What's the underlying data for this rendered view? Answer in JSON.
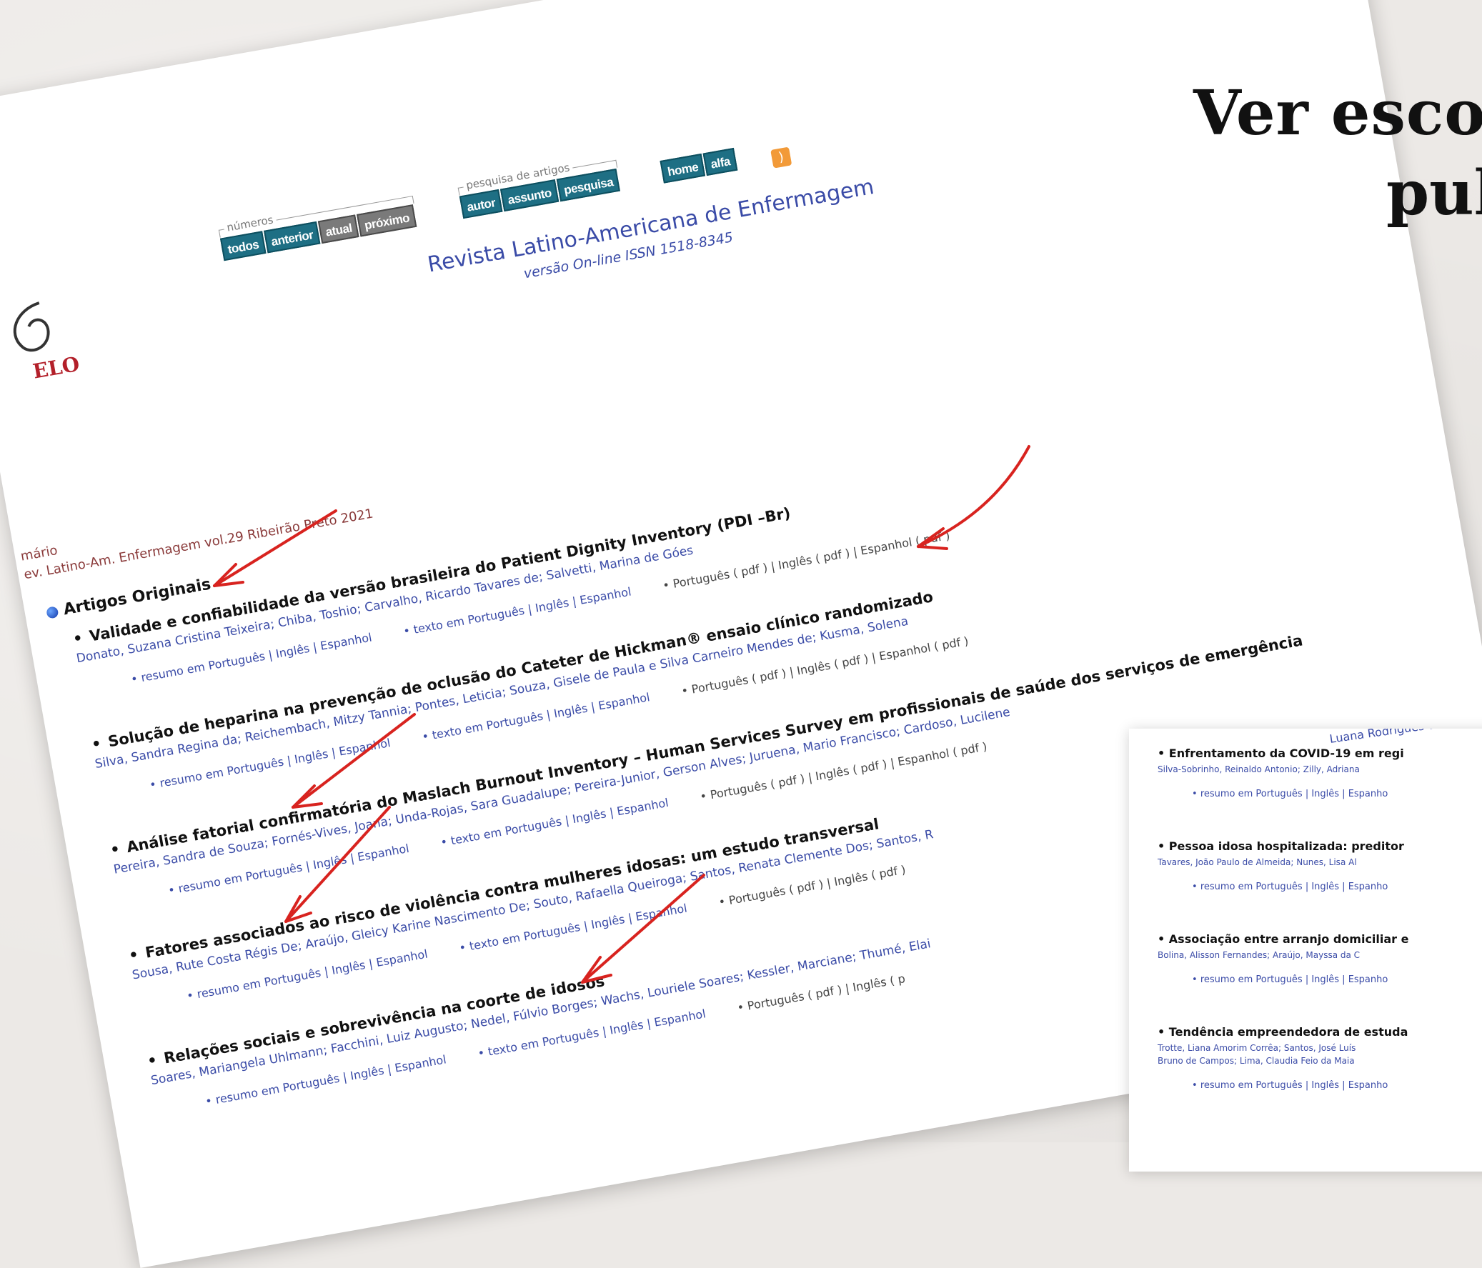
{
  "heading": {
    "line1": "Ver esco",
    "line2": "pul"
  },
  "nav": {
    "group_numeros": "números",
    "group_pesquisa": "pesquisa de artigos",
    "buttons_numeros": [
      "todos",
      "anterior",
      "atual",
      "próximo"
    ],
    "buttons_pesquisa": [
      "autor",
      "assunto",
      "pesquisa"
    ],
    "buttons_misc": [
      "home",
      "alfa"
    ]
  },
  "logo_text": "ELO",
  "journal": {
    "title": "Revista Latino-Americana de Enfermagem",
    "subtitle": "versão On-line ISSN 1518-8345"
  },
  "breadcrumb": {
    "line1": "mário",
    "line2": "ev. Latino-Am. Enfermagem vol.29  Ribeirão Preto  2021"
  },
  "section": "Artigos Originais",
  "articles": [
    {
      "title": "Validade e confiabilidade da versão brasileira do Patient Dignity Inventory (PDI –Br)",
      "authors": "Donato, Suzana Cristina Teixeira; Chiba, Toshio; Carvalho, Ricardo Tavares de; Salvetti, Marina de Góes",
      "resumo": "resumo em Português | Inglês | Espanhol",
      "texto": "texto em Português | Inglês | Espanhol",
      "pdf": "Português ( pdf ) | Inglês ( pdf ) | Espanhol ( pdf )"
    },
    {
      "title": "Solução de heparina na prevenção de oclusão do Cateter de Hickman® ensaio clínico randomizado",
      "authors": "Silva, Sandra Regina da; Reichembach, Mitzy Tannia; Pontes, Leticia; Souza, Gisele de Paula e Silva Carneiro Mendes de; Kusma, Solena",
      "resumo": "resumo em Português | Inglês | Espanhol",
      "texto": "texto em Português | Inglês | Espanhol",
      "pdf": "Português ( pdf ) | Inglês ( pdf ) | Espanhol ( pdf )"
    },
    {
      "title": "Análise fatorial confirmatória do Maslach Burnout Inventory – Human Services Survey em profissionais de saúde dos serviços de emergência",
      "authors": "Pereira, Sandra de Souza; Fornés-Vives, Joana; Unda-Rojas, Sara Guadalupe; Pereira-Junior, Gerson Alves; Juruena, Mario Francisco; Cardoso, Lucilene",
      "resumo": "resumo em Português | Inglês | Espanhol",
      "texto": "texto em Português | Inglês | Espanhol",
      "pdf": "Português ( pdf ) | Inglês ( pdf ) | Espanhol ( pdf )"
    },
    {
      "title": "Fatores associados ao risco de violência contra mulheres idosas: um estudo transversal",
      "authors": "Sousa, Rute Costa Régis De; Araújo, Gleicy Karine Nascimento De; Souto, Rafaella Queiroga; Santos, Renata Clemente Dos; Santos, R",
      "resumo": "resumo em Português | Inglês | Espanhol",
      "texto": "texto em Português | Inglês | Espanhol",
      "pdf": "Português ( pdf ) | Inglês ( pdf )"
    },
    {
      "title": "Relações sociais e sobrevivência na coorte de idosos",
      "authors": "Soares, Mariangela Uhlmann; Facchini, Luiz Augusto; Nedel, Fúlvio Borges; Wachs, Louriele Soares; Kessler, Marciane; Thumé, Elai",
      "resumo": "resumo em Português | Inglês | Espanhol",
      "texto": "texto em Português | Inglês | Espanhol",
      "pdf": "Português ( pdf ) | Inglês ( p"
    }
  ],
  "card2": {
    "top_fragment": "Luana Rodrigues de",
    "items": [
      {
        "title": "Enfrentamento da COVID-19 em regi",
        "authors": "Silva-Sobrinho, Reinaldo Antonio; Zilly, Adriana",
        "resumo": "resumo em Português | Inglês | Espanho"
      },
      {
        "title": "Pessoa idosa hospitalizada: preditor",
        "authors": "Tavares, João Paulo de Almeida; Nunes, Lisa Al",
        "resumo": "resumo em Português | Inglês | Espanho"
      },
      {
        "title": "Associação entre arranjo domiciliar e",
        "authors": "Bolina, Alisson Fernandes; Araújo, Mayssa da C",
        "resumo": "resumo em Português | Inglês | Espanho"
      },
      {
        "title": "Tendência empreendedora de estuda",
        "authors": "Trotte, Liana Amorim Corrêa; Santos, José Luís",
        "authors2": "Bruno de Campos; Lima, Claudia Feio da Maia",
        "resumo": "resumo em Português | Inglês | Espanho"
      }
    ]
  },
  "colors": {
    "background": "#ece9e6",
    "link_blue": "#3a4ba7",
    "button_teal": "#1e6f84",
    "button_gray": "#7a7a7a",
    "arrow_red": "#d8231f",
    "breadcrumb": "#8a3a3a"
  },
  "icons": [
    "rss-icon",
    "pdf-icon",
    "scielo-logo-icon",
    "bullet-dot-icon",
    "red-arrow-icon"
  ]
}
